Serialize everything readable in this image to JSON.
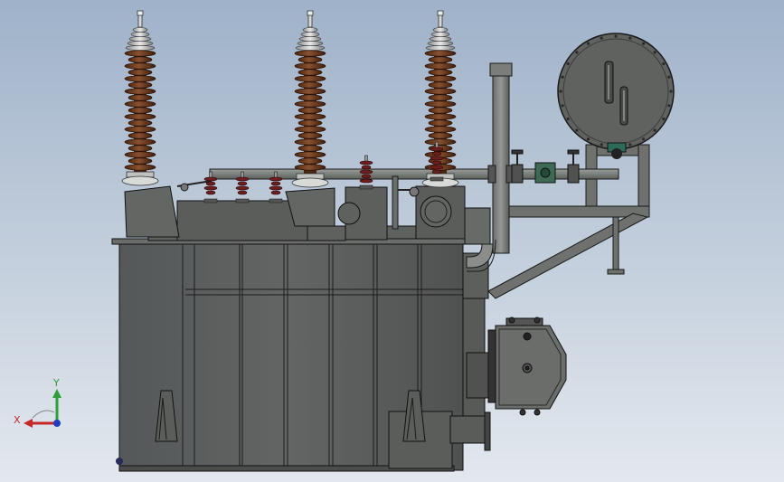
{
  "viewport": {
    "background_top": "#9fb2c9",
    "background_bottom": "#e3e8ee",
    "model_colors": {
      "tank": "#5c5f5c",
      "tank_edge": "#1a1a1a",
      "porcelain": "#6a3a1e",
      "porcelain_light": "#8a5230",
      "metal": "#7e827e",
      "red_bushing": "#6e1e1e"
    }
  },
  "triad": {
    "x_label": "X",
    "y_label": "Y",
    "x_color": "#c62828",
    "y_color": "#2e9d3a",
    "z_color": "#1f3fbf"
  }
}
